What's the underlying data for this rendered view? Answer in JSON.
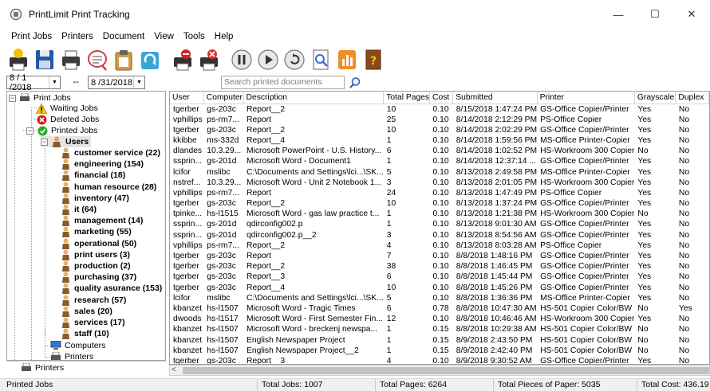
{
  "window": {
    "title": "PrintLimit Print Tracking",
    "minimize": "—",
    "maximize": "☐",
    "close": "✕"
  },
  "menu": [
    "Print Jobs",
    "Printers",
    "Document",
    "View",
    "Tools",
    "Help"
  ],
  "toolbar_icons": [
    "print-user-icon",
    "save-icon",
    "printer-icon",
    "search-document-icon",
    "clipboard-icon",
    "refresh-icon",
    "stop-printer-icon",
    "cancel-printer-icon",
    "pause-icon",
    "play-icon",
    "restart-icon",
    "print-preview-icon",
    "chart-icon",
    "help-book-icon"
  ],
  "filter": {
    "date_from": "8 / 1 /2018",
    "date_to": "8 /31/2018",
    "separator": "--",
    "search_placeholder": "Search printed documents"
  },
  "tree": {
    "root": "Print Jobs",
    "waiting": "Waiting Jobs",
    "deleted": "Deleted Jobs",
    "printed": "Printed Jobs",
    "users": "Users",
    "departments": [
      "customer service (22)",
      "engineering (154)",
      "financial (18)",
      "human resource (28)",
      "inventory (47)",
      "it (64)",
      "management (14)",
      "marketing (55)",
      "operational (50)",
      "print users (3)",
      "production (2)",
      "purchasing (37)",
      "quality asurance (153)",
      "research (57)",
      "sales (20)",
      "services (17)",
      "staff (10)"
    ],
    "computers": "Computers",
    "printers_sub": "Printers",
    "printers_root": "Printers"
  },
  "grid": {
    "columns": [
      "User",
      "Computer",
      "Description",
      "Total Pages",
      "Cost",
      "Submitted",
      "Printer",
      "Grayscale",
      "Duplex"
    ],
    "rows": [
      [
        "tgerber",
        "gs-203c",
        "Report__2",
        "10",
        "0.10",
        "8/15/2018 1:47:24 PM",
        "GS-Office Copier/Printer",
        "Yes",
        "No"
      ],
      [
        "vphillips",
        "ps-rm7...",
        "Report",
        "25",
        "0.10",
        "8/14/2018 2:12:29 PM",
        "PS-Office Copier",
        "Yes",
        "No"
      ],
      [
        "tgerber",
        "gs-203c",
        "Report__2",
        "10",
        "0.10",
        "8/14/2018 2:02:29 PM",
        "GS-Office Copier/Printer",
        "Yes",
        "No"
      ],
      [
        "kkibbe",
        "ms-332d",
        "Report__4",
        "1",
        "0.10",
        "8/14/2018 1:59:56 PM",
        "MS-Office Printer-Copier",
        "Yes",
        "No"
      ],
      [
        "dlandes",
        "10.3.29...",
        "Microsoft PowerPoint - U.S. History...",
        "6",
        "0.10",
        "8/14/2018 1:02:52 PM",
        "HS-Workroom 300 Copier",
        "No",
        "No"
      ],
      [
        "ssprin...",
        "gs-201d",
        "Microsoft Word - Document1",
        "1",
        "0.10",
        "8/14/2018 12:37:14 ...",
        "GS-Office Copier/Printer",
        "Yes",
        "No"
      ],
      [
        "lcifor",
        "mslibc",
        "C:\\Documents and Settings\\lci...\\SK...",
        "5",
        "0.10",
        "8/13/2018 2:49:58 PM",
        "MS-Office Printer-Copier",
        "Yes",
        "No"
      ],
      [
        "nstref...",
        "10.3.29...",
        "Microsoft Word - Unit 2 Notebook 1...",
        "3",
        "0.10",
        "8/13/2018 2:01:05 PM",
        "HS-Workroom 300 Copier",
        "Yes",
        "No"
      ],
      [
        "vphillips",
        "ps-rm7...",
        "Report",
        "24",
        "0.10",
        "8/13/2018 1:47:49 PM",
        "PS-Office Copier",
        "Yes",
        "No"
      ],
      [
        "tgerber",
        "gs-203c",
        "Report__2",
        "10",
        "0.10",
        "8/13/2018 1:37:24 PM",
        "GS-Office Copier/Printer",
        "Yes",
        "No"
      ],
      [
        "tpinke...",
        "hs-l1515",
        "Microsoft Word - gas law practice t...",
        "1",
        "0.10",
        "8/13/2018 1:21:38 PM",
        "HS-Workroom 300 Copier",
        "No",
        "No"
      ],
      [
        "ssprin...",
        "gs-201d",
        "qdirconfig002.p",
        "1",
        "0.10",
        "8/13/2018 9:01:30 AM",
        "GS-Office Copier/Printer",
        "Yes",
        "No"
      ],
      [
        "ssprin...",
        "gs-201d",
        "qdirconfig002.p__2",
        "3",
        "0.10",
        "8/13/2018 8:54:56 AM",
        "GS-Office Copier/Printer",
        "Yes",
        "No"
      ],
      [
        "vphillips",
        "ps-rm7...",
        "Report__2",
        "4",
        "0.10",
        "8/13/2018 8:03:28 AM",
        "PS-Office Copier",
        "Yes",
        "No"
      ],
      [
        "tgerber",
        "gs-203c",
        "Report",
        "7",
        "0.10",
        "8/8/2018 1:48:16 PM",
        "GS-Office Copier/Printer",
        "Yes",
        "No"
      ],
      [
        "tgerber",
        "gs-203c",
        "Report__2",
        "38",
        "0.10",
        "8/8/2018 1:46:45 PM",
        "GS-Office Copier/Printer",
        "Yes",
        "No"
      ],
      [
        "tgerber",
        "gs-203c",
        "Report__3",
        "6",
        "0.10",
        "8/8/2018 1:45:44 PM",
        "GS-Office Copier/Printer",
        "Yes",
        "No"
      ],
      [
        "tgerber",
        "gs-203c",
        "Report__4",
        "10",
        "0.10",
        "8/8/2018 1:45:26 PM",
        "GS-Office Copier/Printer",
        "Yes",
        "No"
      ],
      [
        "lcifor",
        "mslibc",
        "C:\\Documents and Settings\\lci...\\SK...",
        "5",
        "0.10",
        "8/8/2018 1:36:36 PM",
        "MS-Office Printer-Copier",
        "Yes",
        "No"
      ],
      [
        "kbanzet",
        "hs-l1507",
        "Microsoft Word - Tragic Times",
        "6",
        "0.78",
        "8/8/2018 10:47:30 AM",
        "HS-501 Copier Color/BW",
        "No",
        "Yes"
      ],
      [
        "dwoods",
        "hs-l1517",
        "Microsoft Word - First Semester Fin...",
        "12",
        "0.10",
        "8/8/2018 10:46:46 AM",
        "HS-Workroom 300 Copier",
        "Yes",
        "No"
      ],
      [
        "kbanzet",
        "hs-l1507",
        "Microsoft Word - breckenj newspa...",
        "1",
        "0.15",
        "8/8/2018 10:29:38 AM",
        "HS-501 Copier Color/BW",
        "No",
        "No"
      ],
      [
        "kbanzet",
        "hs-l1507",
        "English Newspaper Project",
        "1",
        "0.15",
        "8/9/2018 2:43:50 PM",
        "HS-501 Copier Color/BW",
        "No",
        "No"
      ],
      [
        "kbanzet",
        "hs-l1507",
        "English Newspaper Project__2",
        "1",
        "0.15",
        "8/9/2018 2:42:40 PM",
        "HS-501 Copier Color/BW",
        "No",
        "No"
      ],
      [
        "tgerber",
        "gs-203c",
        "Report__3",
        "4",
        "0.10",
        "8/9/2018 9:30:52 AM",
        "GS-Office Copier/Printer",
        "Yes",
        "No"
      ]
    ]
  },
  "status": {
    "section": "Printed Jobs",
    "total_jobs": "Total Jobs: 1007",
    "total_pages": "Total Pages: 6264",
    "total_paper": "Total Pieces of Paper: 5035",
    "total_cost": "Total Cost: 436.19"
  }
}
